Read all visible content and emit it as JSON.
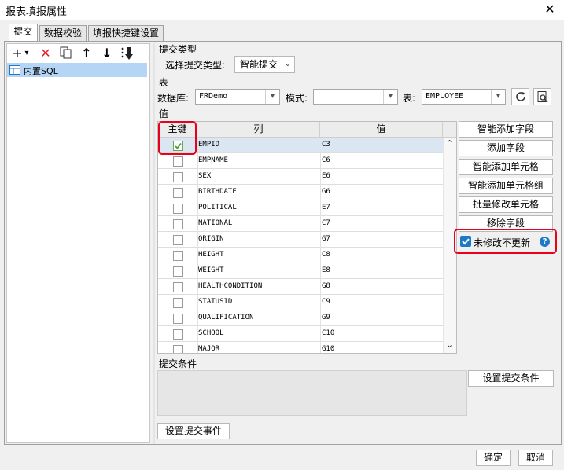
{
  "window": {
    "title": "报表填报属性",
    "close_glyph": "✕"
  },
  "tabs": [
    {
      "label": "提交",
      "active": true
    },
    {
      "label": "数据校验",
      "active": false
    },
    {
      "label": "填报快捷键设置",
      "active": false
    }
  ],
  "toolbar": {
    "add_glyph": "+",
    "dropdown_glyph": "▾",
    "delete_glyph": "✕",
    "up_glyph": "↑",
    "down_glyph": "↓"
  },
  "tree": {
    "items": [
      {
        "label": "内置SQL",
        "selected": true
      }
    ]
  },
  "submit_type": {
    "section_label": "提交类型",
    "field_label": "选择提交类型:",
    "value": "智能提交"
  },
  "table_section": {
    "section_label": "表",
    "database_label": "数据库:",
    "database_value": "FRDemo",
    "schema_label": "模式:",
    "schema_value": "",
    "table_label": "表:",
    "table_value": "EMPLOYEE"
  },
  "value_section": {
    "section_label": "值"
  },
  "grid": {
    "headers": [
      "主键",
      "列",
      "值"
    ],
    "rows": [
      {
        "key": true,
        "column": "EMPID",
        "value": "C3"
      },
      {
        "key": false,
        "column": "EMPNAME",
        "value": "C6"
      },
      {
        "key": false,
        "column": "SEX",
        "value": "E6"
      },
      {
        "key": false,
        "column": "BIRTHDATE",
        "value": "G6"
      },
      {
        "key": false,
        "column": "POLITICAL",
        "value": "E7"
      },
      {
        "key": false,
        "column": "NATIONAL",
        "value": "C7"
      },
      {
        "key": false,
        "column": "ORIGIN",
        "value": "G7"
      },
      {
        "key": false,
        "column": "HEIGHT",
        "value": "C8"
      },
      {
        "key": false,
        "column": "WEIGHT",
        "value": "E8"
      },
      {
        "key": false,
        "column": "HEALTHCONDITION",
        "value": "G8"
      },
      {
        "key": false,
        "column": "STATUSID",
        "value": "C9"
      },
      {
        "key": false,
        "column": "QUALIFICATION",
        "value": "G9"
      },
      {
        "key": false,
        "column": "SCHOOL",
        "value": "C10"
      },
      {
        "key": false,
        "column": "MAJOR",
        "value": "G10"
      }
    ]
  },
  "side_buttons": [
    "智能添加字段",
    "添加字段",
    "智能添加单元格",
    "智能添加单元格组",
    "批量修改单元格",
    "移除字段"
  ],
  "no_update_option": {
    "label": "未修改不更新",
    "checked": true,
    "help_glyph": "?"
  },
  "submit_condition": {
    "section_label": "提交条件",
    "button_label": "设置提交条件"
  },
  "submit_event_button": "设置提交事件",
  "footer": {
    "ok_label": "确定",
    "cancel_label": "取消"
  },
  "colors": {
    "highlight_red": "#e8001c",
    "selection_blue": "#b4d5f5",
    "check_green": "#4a9b2e",
    "accent_blue": "#1e78c8"
  }
}
